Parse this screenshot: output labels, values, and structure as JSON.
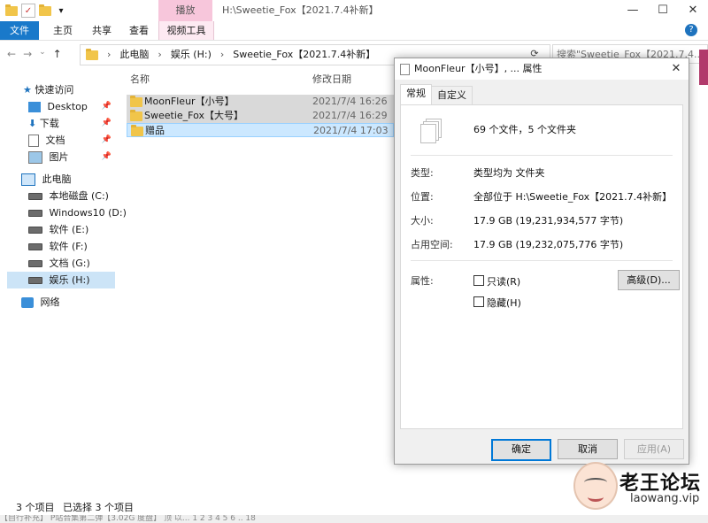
{
  "titlebar": {
    "context_tab": "播放",
    "window_title": "H:\\Sweetie_Fox【2021.7.4补新】",
    "controls": [
      "—",
      "☐",
      "✕"
    ]
  },
  "ribbon": {
    "tabs": [
      "文件",
      "主页",
      "共享",
      "查看",
      "视频工具"
    ],
    "help": "?"
  },
  "addressbar": {
    "crumbs": [
      "此电脑",
      "娱乐 (H:)",
      "Sweetie_Fox【2021.7.4补新】"
    ],
    "search_placeholder": "搜索\"Sweetie_Fox【2021.7.4...\""
  },
  "navpane": {
    "items": [
      {
        "label": "快速访问",
        "icon": "star-icon"
      },
      {
        "label": "Desktop",
        "icon": "desktop-icon",
        "pinned": true
      },
      {
        "label": "下载",
        "icon": "download-icon",
        "pinned": true
      },
      {
        "label": "文档",
        "icon": "document-icon",
        "pinned": true
      },
      {
        "label": "图片",
        "icon": "picture-icon",
        "pinned": true
      },
      {
        "label": "此电脑",
        "icon": "computer-icon"
      },
      {
        "label": "本地磁盘 (C:)",
        "icon": "drive-icon"
      },
      {
        "label": "Windows10 (D:)",
        "icon": "drive-icon"
      },
      {
        "label": "软件 (E:)",
        "icon": "drive-icon"
      },
      {
        "label": "软件 (F:)",
        "icon": "drive-icon"
      },
      {
        "label": "文档 (G:)",
        "icon": "drive-icon"
      },
      {
        "label": "娱乐 (H:)",
        "icon": "drive-icon",
        "selected": true
      },
      {
        "label": "网络",
        "icon": "network-icon"
      }
    ]
  },
  "filelist": {
    "columns": [
      "名称",
      "修改日期"
    ],
    "rows": [
      {
        "name": "MoonFleur【小号】",
        "date": "2021/7/4 16:26"
      },
      {
        "name": "Sweetie_Fox【大号】",
        "date": "2021/7/4 16:29"
      },
      {
        "name": "赠品",
        "date": "2021/7/4 17:03"
      }
    ]
  },
  "statusbar": {
    "count": "3 个项目",
    "selected": "已选择 3 个项目"
  },
  "bottom_strip": "【自行补充】 P站合集第二弹【3.02G 度盘】 顶 以... 1 2 3 4 5 6 .. 18",
  "dialog": {
    "title": "MoonFleur【小号】, ... 属性",
    "tabs": [
      "常规",
      "自定义"
    ],
    "summary": "69 个文件，5 个文件夹",
    "props": [
      {
        "label": "类型:",
        "value": "类型均为 文件夹"
      },
      {
        "label": "位置:",
        "value": "全部位于 H:\\Sweetie_Fox【2021.7.4补新】"
      },
      {
        "label": "大小:",
        "value": "17.9 GB (19,231,934,577 字节)"
      },
      {
        "label": "占用空间:",
        "value": "17.9 GB (19,232,075,776 字节)"
      }
    ],
    "attributes_label": "属性:",
    "readonly_label": "只读(R)",
    "hidden_label": "隐藏(H)",
    "advanced_button": "高级(D)...",
    "ok_button": "确定",
    "cancel_button": "取消",
    "apply_button": "应用(A)"
  },
  "watermark": {
    "text": "老王论坛",
    "url": "laowang.vip"
  },
  "colors": {
    "file_tab": "#1979ca",
    "context_tab": "#f7c6db",
    "selection": "#cce8ff",
    "folder": "#f1c54a"
  }
}
